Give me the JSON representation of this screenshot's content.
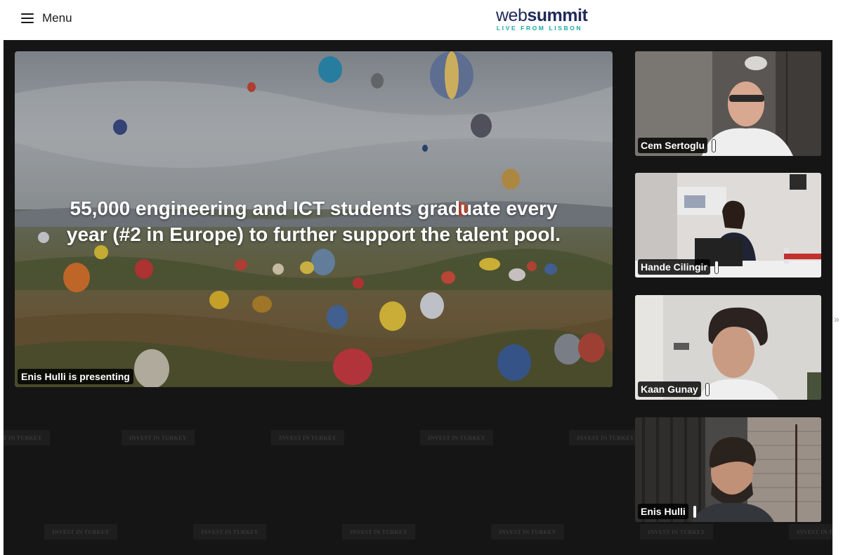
{
  "header": {
    "menu_label": "Menu",
    "logo": {
      "web": "web",
      "summit": "summit",
      "tagline": "LIVE FROM LISBON"
    }
  },
  "watermark_text": "INVEST IN TURKEY",
  "presentation": {
    "slide_line1": "55,000 engineering and ICT students graduate every",
    "slide_line2": "year (#2 in Europe) to further support the talent pool.",
    "presenter_label": "Enis Hulli is presenting"
  },
  "participants": [
    {
      "name": "Cem Sertoglu"
    },
    {
      "name": "Hande Cilingir"
    },
    {
      "name": "Kaan Gunay"
    },
    {
      "name": "Enis Hulli"
    }
  ],
  "side_arrow": "»"
}
